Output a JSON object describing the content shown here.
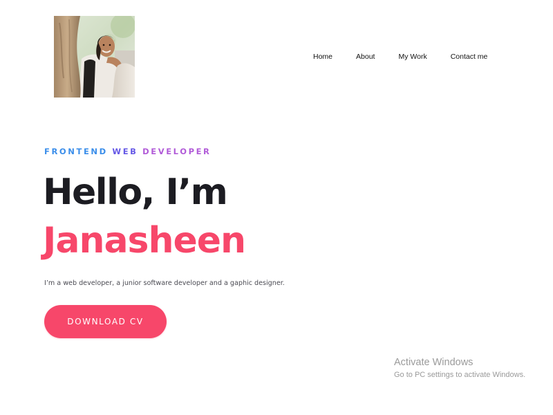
{
  "header": {
    "profile_photo": "profile-photo",
    "nav": [
      {
        "label": "Home"
      },
      {
        "label": "About"
      },
      {
        "label": "My Work"
      },
      {
        "label": "Contact me"
      }
    ]
  },
  "hero": {
    "subtitle_words": [
      "FRONTEND",
      "WEB",
      "DEVELOPER"
    ],
    "greeting": "Hello, I’m",
    "name": "Janasheen",
    "description": "I’m a web developer, a junior software developer and a gaphic designer.",
    "cta_label": "DOWNLOAD CV"
  },
  "watermark": {
    "title": "Activate Windows",
    "subtitle": "Go to PC settings to activate Windows."
  },
  "colors": {
    "accent": "#f7476a",
    "heading": "#1c1c22",
    "subtitle_gradient": [
      "#3b8eea",
      "#6558e6",
      "#b15bd8"
    ]
  }
}
